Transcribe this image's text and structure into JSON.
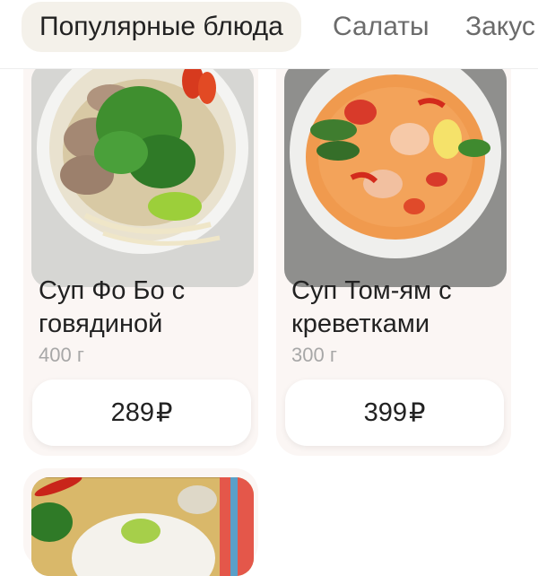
{
  "tabs": [
    {
      "label": "Популярные блюда",
      "active": true
    },
    {
      "label": "Салаты",
      "active": false
    },
    {
      "label": "Закус",
      "active": false
    }
  ],
  "products": [
    {
      "name_line1": "Суп Фо Бо с",
      "name_line2": "говядиной",
      "weight": "400 г",
      "price": "289",
      "currency": "₽",
      "image_icon": "pho-bo-soup-photo"
    },
    {
      "name_line1": "Суп Том-ям с",
      "name_line2": "креветками",
      "weight": "300 г",
      "price": "399",
      "currency": "₽",
      "image_icon": "tom-yum-soup-photo"
    },
    {
      "image_icon": "dish-photo-partial"
    }
  ],
  "colors": {
    "tab_active_bg": "#f4f1ea",
    "card_bg": "#fbf6f4",
    "weight_text": "#a7a7a7"
  }
}
